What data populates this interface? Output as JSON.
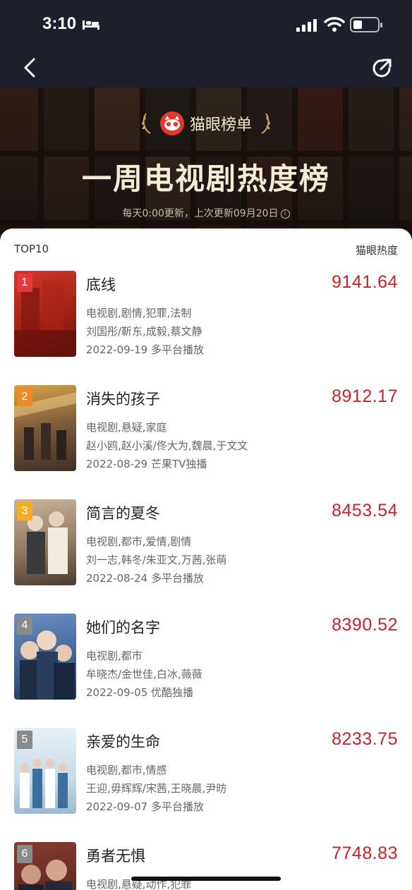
{
  "status_bar": {
    "time": "3:10"
  },
  "hero": {
    "brand": "猫眼榜单",
    "title": "一周电视剧热度榜",
    "subtitle": "每天0:00更新，上次更新09月20日"
  },
  "list": {
    "header_left": "TOP10",
    "header_right": "猫眼热度",
    "items": [
      {
        "rank": "1",
        "title": "底线",
        "score": "9141.64",
        "genres": "电视剧,剧情,犯罪,法制",
        "cast": "刘国彤/靳东,成毅,蔡文静",
        "release": "2022-09-19 多平台播放",
        "badge_color": "#e23a3a",
        "poster_color": "#b4241c"
      },
      {
        "rank": "2",
        "title": "消失的孩子",
        "score": "8912.17",
        "genres": "电视剧,悬疑,家庭",
        "cast": "赵小鸥,赵小溪/佟大为,魏晨,于文文",
        "release": "2022-08-29 芒果TV独播",
        "badge_color": "#f08a24",
        "poster_color": "#7a5a3c"
      },
      {
        "rank": "3",
        "title": "简言的夏冬",
        "score": "8453.54",
        "genres": "电视剧,都市,爱情,剧情",
        "cast": "刘一志,韩冬/朱亚文,万茜,张萌",
        "release": "2022-08-24 多平台播放",
        "badge_color": "#f2b01e",
        "poster_color": "#8f7a62"
      },
      {
        "rank": "4",
        "title": "她们的名字",
        "score": "8390.52",
        "genres": "电视剧,都市",
        "cast": "牟晓杰/金世佳,白冰,薇薇",
        "release": "2022-09-05 优酷独播",
        "badge_color": "#8a8a8a",
        "poster_color": "#3f5f8f"
      },
      {
        "rank": "5",
        "title": "亲爱的生命",
        "score": "8233.75",
        "genres": "电视剧,都市,情感",
        "cast": "王迎,毋辉辉/宋茜,王晓晨,尹昉",
        "release": "2022-09-07 多平台播放",
        "badge_color": "#8a8a8a",
        "poster_color": "#c7dbe8"
      },
      {
        "rank": "6",
        "title": "勇者无惧",
        "score": "7748.83",
        "genres": "电视剧,悬疑,动作,犯罪",
        "cast": "",
        "release": "",
        "badge_color": "#8a8a8a",
        "poster_color": "#5a2a24"
      }
    ]
  }
}
